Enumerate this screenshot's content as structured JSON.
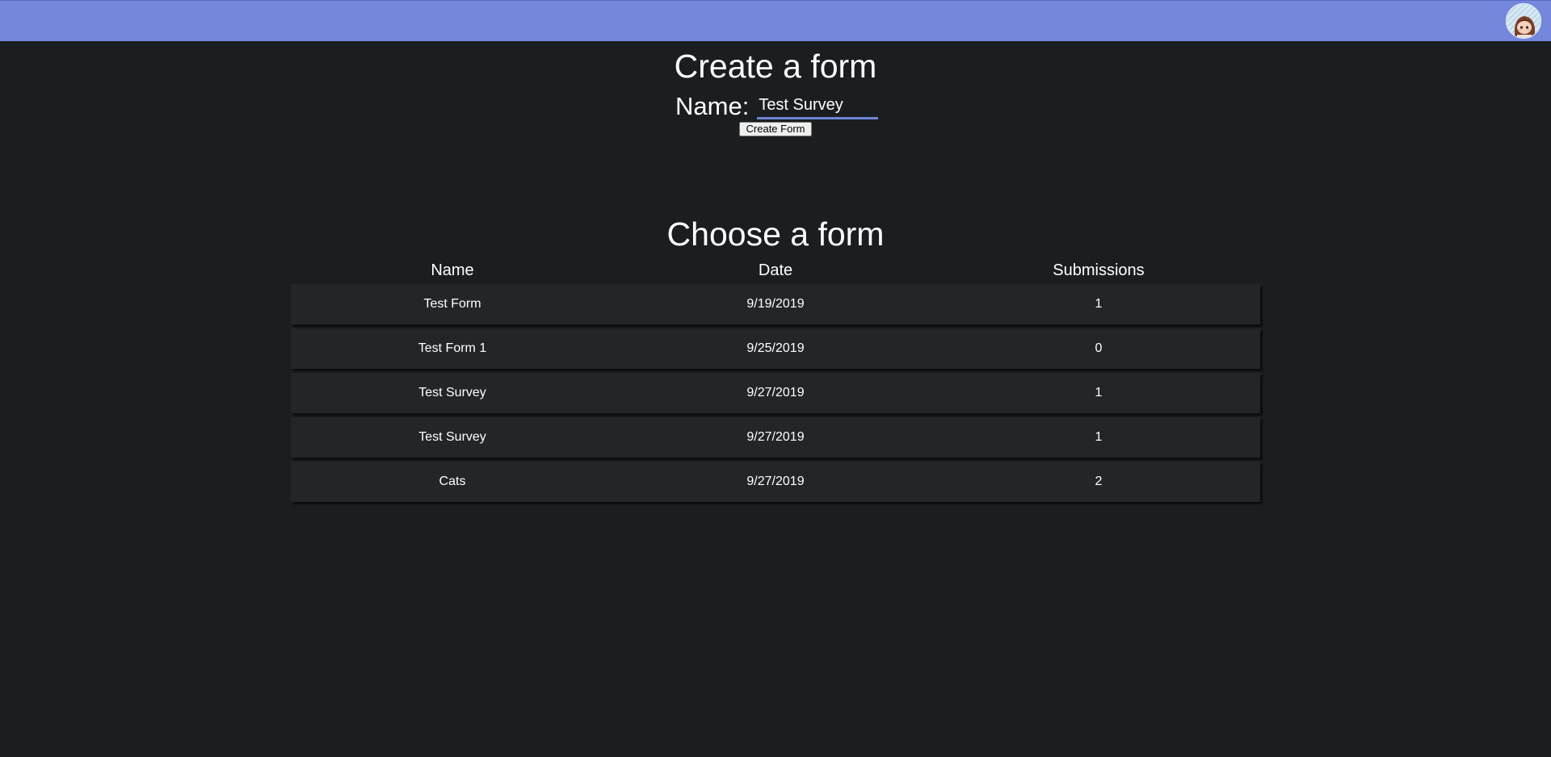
{
  "header": {
    "brand_color": "#7487dc",
    "avatar_icon": "user-avatar-icon"
  },
  "create": {
    "title": "Create a form",
    "name_label": "Name:",
    "name_value": "Test Survey",
    "button_label": "Create Form"
  },
  "choose": {
    "title": "Choose a form",
    "columns": [
      "Name",
      "Date",
      "Submissions"
    ],
    "rows": [
      {
        "name": "Test Form",
        "date": "9/19/2019",
        "submissions": "1"
      },
      {
        "name": "Test Form 1",
        "date": "9/25/2019",
        "submissions": "0"
      },
      {
        "name": "Test Survey",
        "date": "9/27/2019",
        "submissions": "1"
      },
      {
        "name": "Test Survey",
        "date": "9/27/2019",
        "submissions": "1"
      },
      {
        "name": "Cats",
        "date": "9/27/2019",
        "submissions": "2"
      }
    ]
  }
}
